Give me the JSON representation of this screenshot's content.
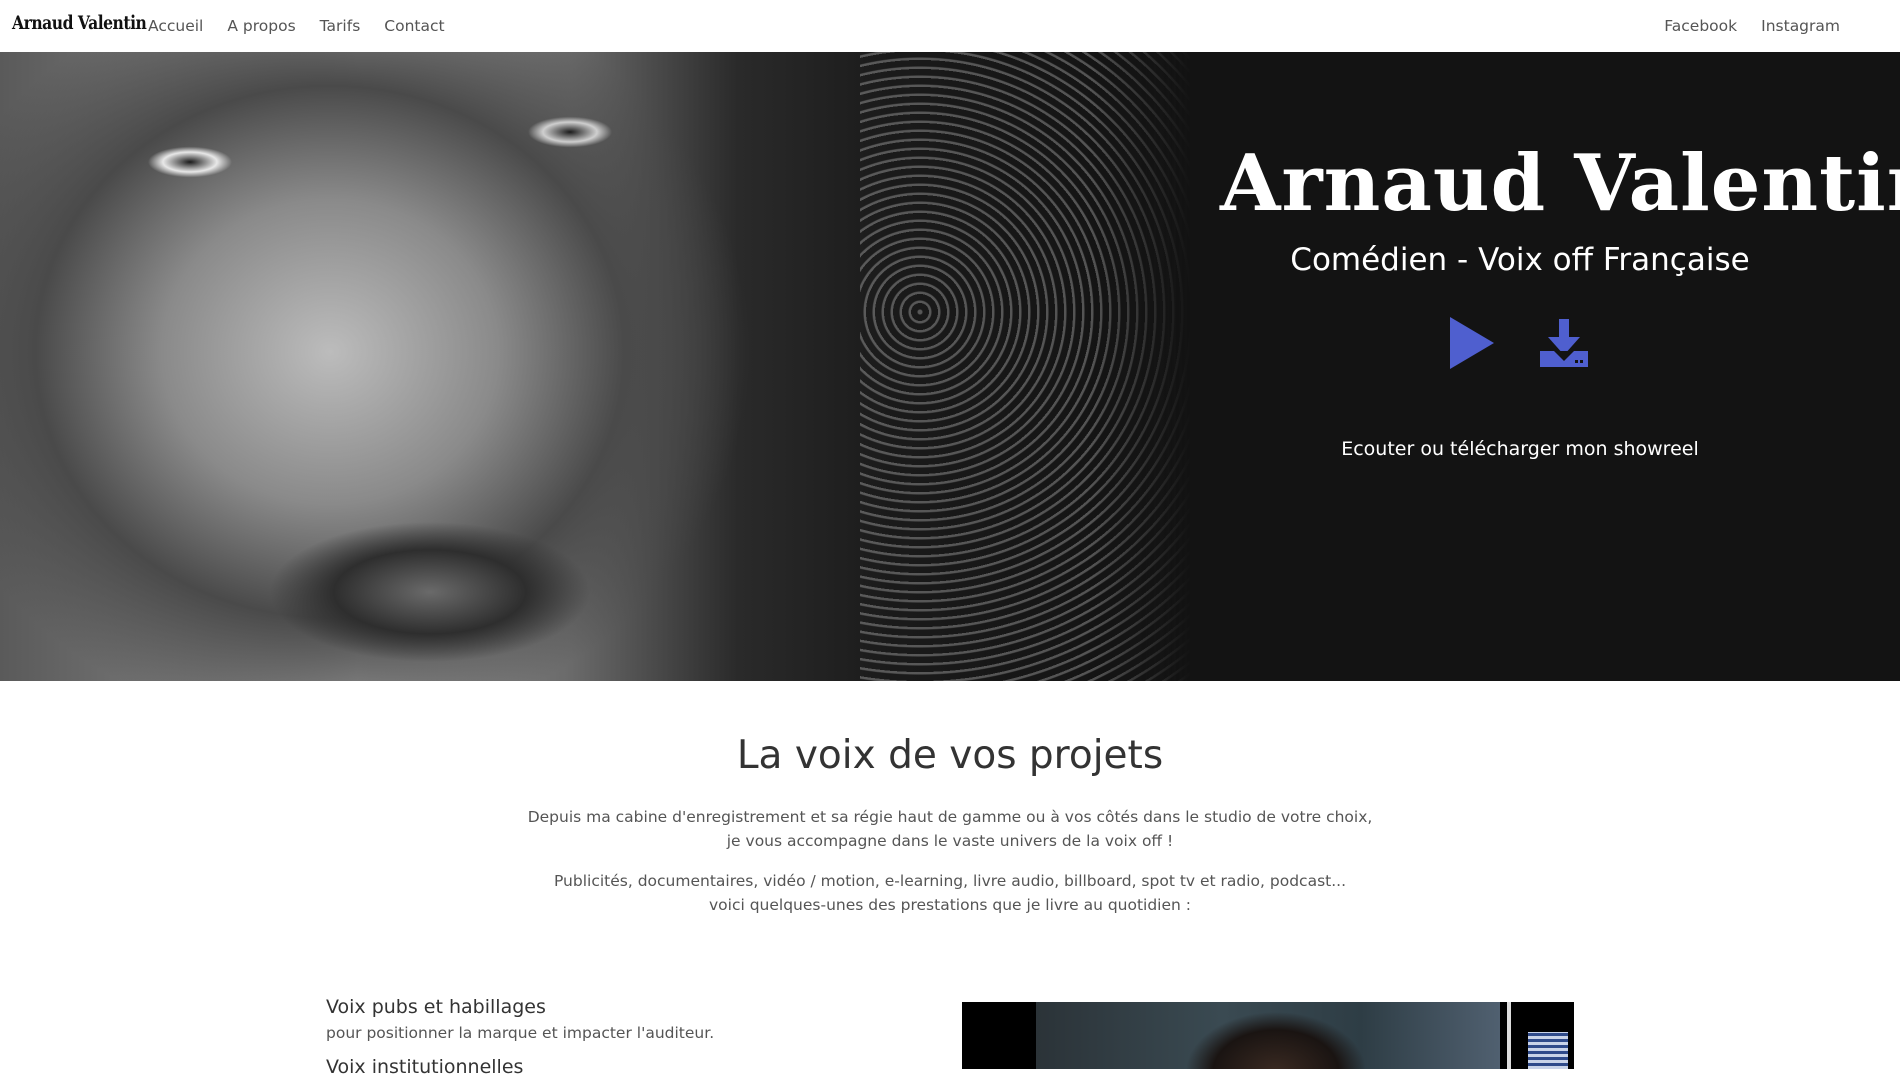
{
  "navbar": {
    "brand": "Arnaud Valentin",
    "left_links": [
      "Accueil",
      "A propos",
      "Tarifs",
      "Contact"
    ],
    "right_links": [
      "Facebook",
      "Instagram"
    ]
  },
  "hero": {
    "title": "Arnaud Valentin",
    "subtitle": "Comédien - Voix off Française",
    "play_icon": "play-icon",
    "download_icon": "download-icon",
    "showreel_label": "Ecouter ou télécharger mon showreel",
    "accent_color": "#4f5fcf"
  },
  "intro": {
    "title": "La voix de vos projets",
    "paragraph1": [
      "Depuis ma cabine d'enregistrement et sa régie haut de gamme ou à vos côtés dans le studio de votre choix,",
      "je vous accompagne dans le vaste univers de la voix off !"
    ],
    "paragraph2": [
      "Publicités, documentaires, vidéo / motion, e-learning, livre audio, billboard, spot tv et radio, podcast...",
      "voici quelques-unes des prestations que je livre au quotidien :"
    ]
  },
  "services": [
    {
      "title": "Voix pubs et habillages",
      "desc": "pour positionner la marque et impacter l'auditeur."
    },
    {
      "title": "Voix institutionnelles",
      "desc": ""
    }
  ]
}
